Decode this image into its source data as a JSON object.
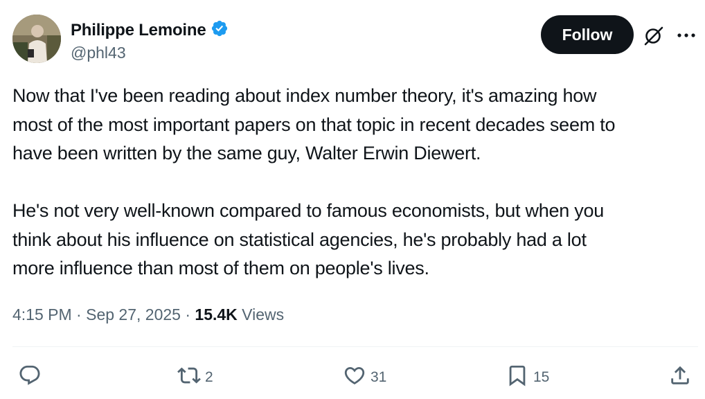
{
  "author": {
    "name": "Philippe Lemoine",
    "handle": "@phl43",
    "verified": true
  },
  "header": {
    "follow_label": "Follow",
    "icons": [
      "grok-icon",
      "more-icon"
    ]
  },
  "tweet": {
    "paragraphs": [
      "Now that I've been reading about index number theory, it's amazing how\nmost of the most important papers on that topic in recent decades seem to\nhave been written by the same guy, Walter Erwin Diewert.",
      "He's not very well-known compared to famous economists, but when you\nthink about his influence on statistical agencies, he's probably had a lot\nmore influence than most of them on people's lives."
    ]
  },
  "meta": {
    "time": "4:15 PM",
    "separator": "·",
    "date": "Sep 27, 2025",
    "views_count": "15.4K",
    "views_label": "Views"
  },
  "actions": {
    "reply_count": "",
    "retweet_count": "2",
    "like_count": "31",
    "bookmark_count": "15"
  },
  "colors": {
    "text": "#0f1419",
    "secondary": "#536471",
    "verified": "#1d9bf0",
    "follow_bg": "#0f1419"
  }
}
